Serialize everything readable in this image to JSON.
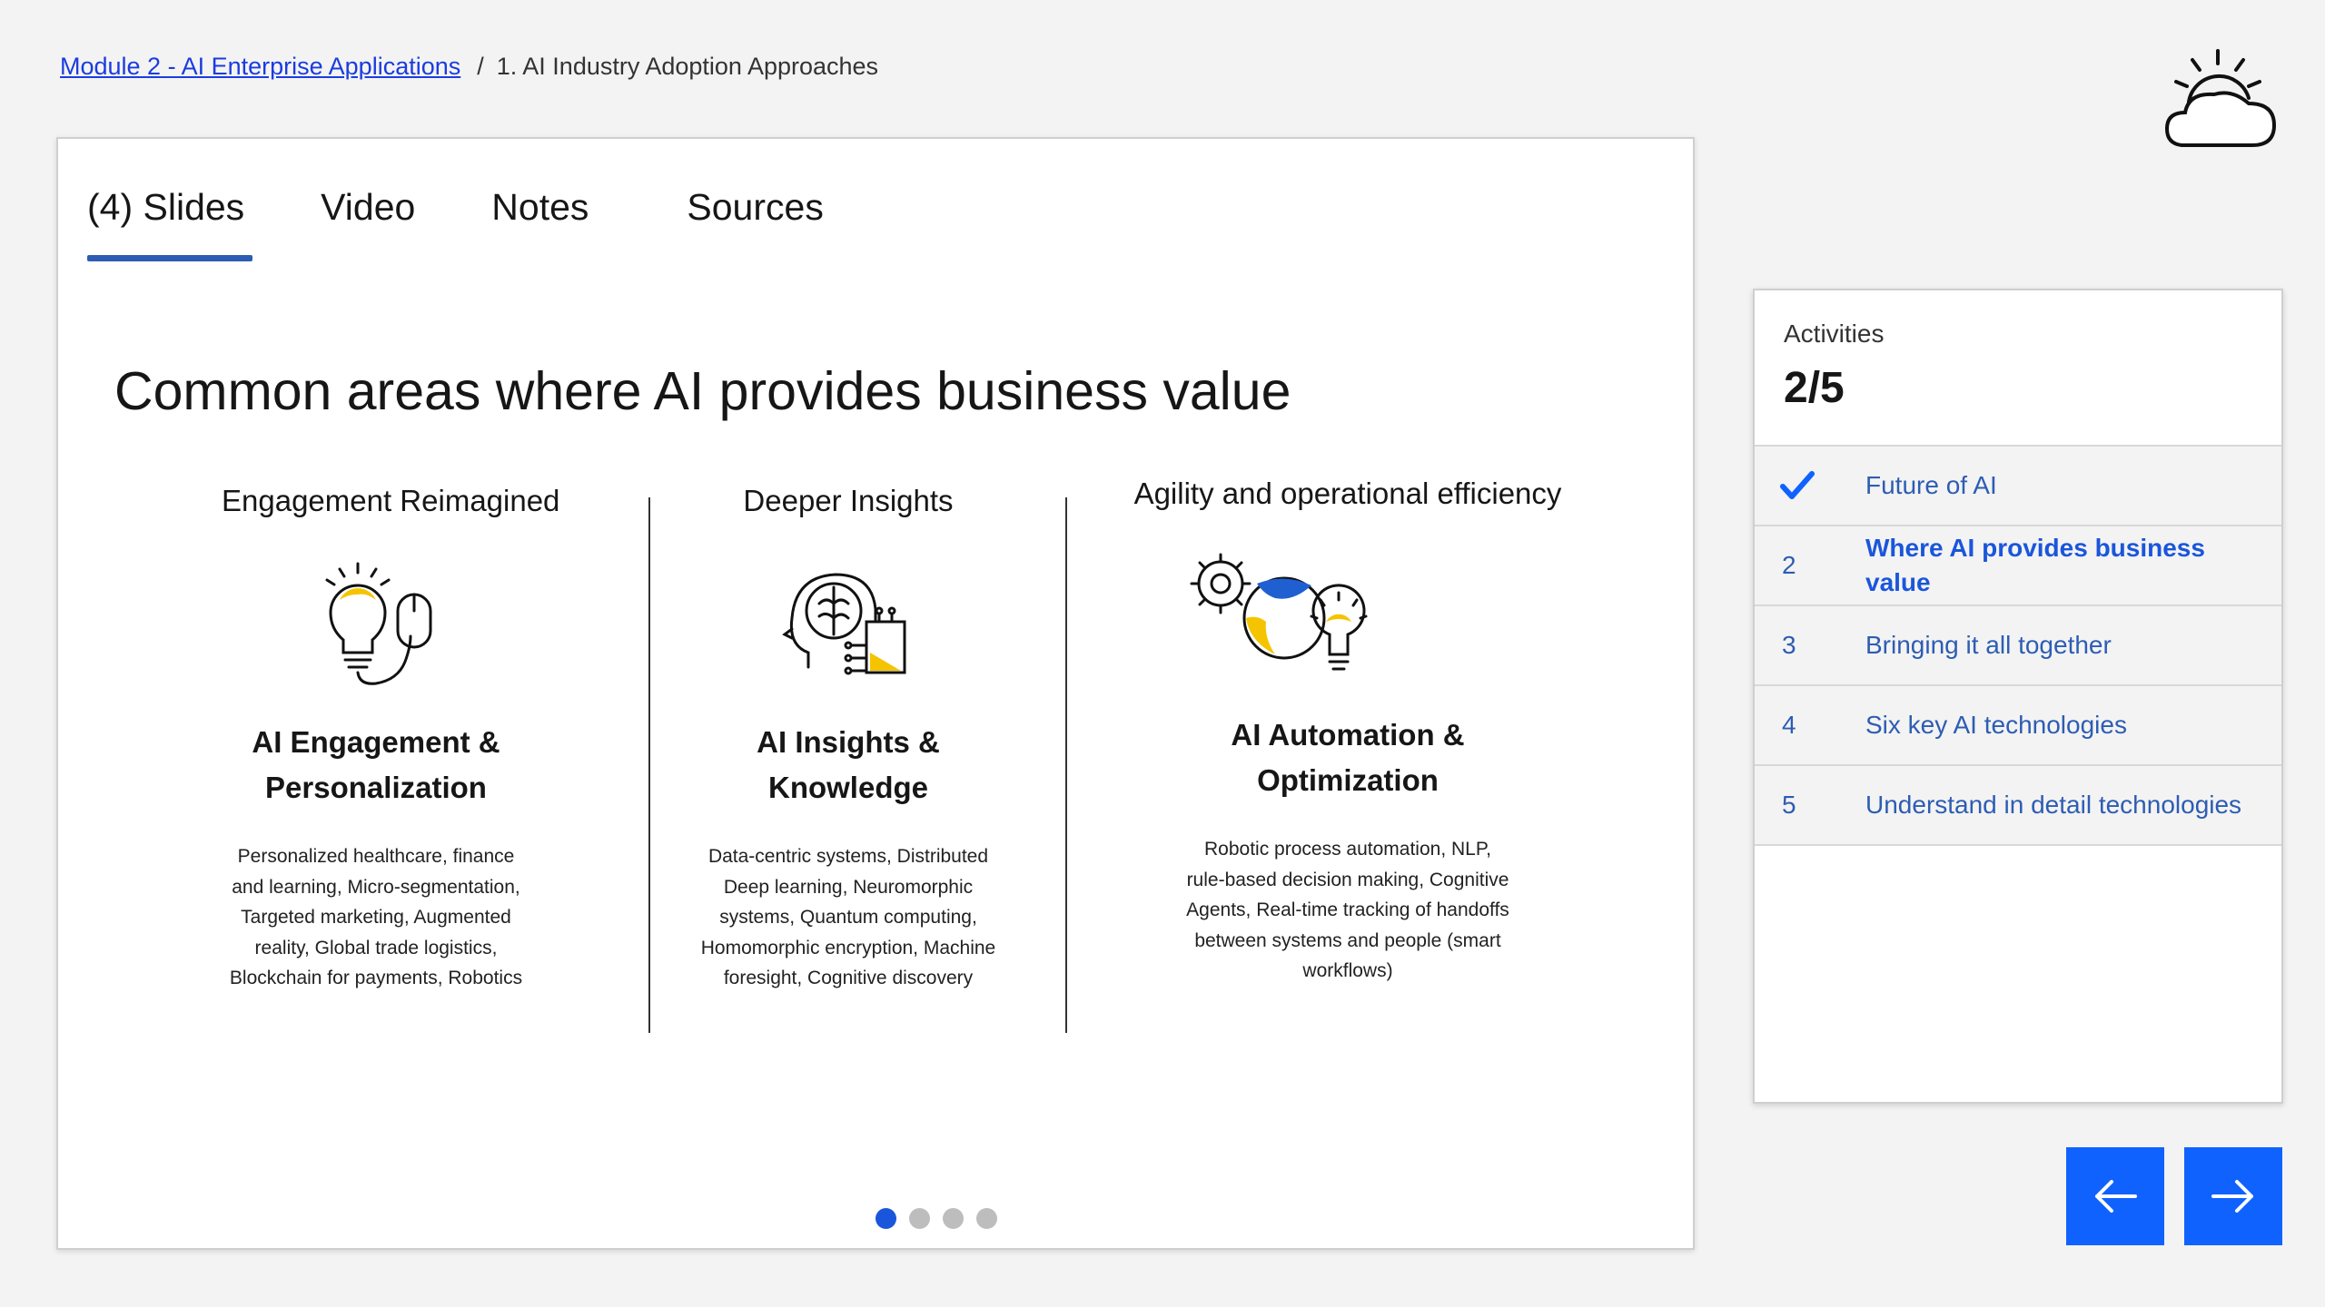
{
  "breadcrumb": {
    "parent": "Module 2 - AI Enterprise Applications",
    "separator": "/",
    "current": "1. AI Industry Adoption Approaches"
  },
  "logo": {
    "icon": "sun-cloud-logo"
  },
  "tabs": [
    {
      "label": "(4) Slides",
      "active": true
    },
    {
      "label": "Video"
    },
    {
      "label": "Notes"
    },
    {
      "label": "Sources"
    }
  ],
  "slide": {
    "title": "Common areas where AI provides business value",
    "columns": [
      {
        "heading": "Engagement Reimagined",
        "icon": "lightbulb-mouse-icon",
        "title_line1": "AI Engagement &",
        "title_line2": "Personalization",
        "desc": [
          "Personalized healthcare, finance",
          "and learning, Micro-segmentation,",
          "Targeted marketing, Augmented",
          "reality, Global trade logistics,",
          "Blockchain for payments, Robotics"
        ]
      },
      {
        "heading": "Deeper Insights",
        "icon": "brain-chart-icon",
        "title_line1": "AI Insights &",
        "title_line2": "Knowledge",
        "desc": [
          "Data-centric systems, Distributed",
          "Deep learning, Neuromorphic",
          "systems, Quantum computing,",
          "Homomorphic encryption, Machine",
          "foresight, Cognitive discovery"
        ]
      },
      {
        "heading": "Agility and operational efficiency",
        "icon": "gear-lightbulb-icon",
        "title_line1": "AI Automation &",
        "title_line2": "Optimization",
        "desc": [
          "Robotic process automation, NLP,",
          "rule-based decision making, Cognitive",
          "Agents, Real-time tracking of handoffs",
          "between systems and people (smart",
          "workflows)"
        ]
      }
    ],
    "pagination": {
      "total": 4,
      "current": 1
    }
  },
  "activities": {
    "label": "Activities",
    "progress": "2/5",
    "items": [
      {
        "num": "",
        "label": "Future of AI",
        "status": "completed"
      },
      {
        "num": "2",
        "label": "Where AI provides business value",
        "status": "current"
      },
      {
        "num": "3",
        "label": "Bringing it all together",
        "status": "pending"
      },
      {
        "num": "4",
        "label": "Six key AI technologies",
        "status": "pending"
      },
      {
        "num": "5",
        "label": "Understand in detail technologies",
        "status": "pending"
      }
    ]
  },
  "nav": {
    "prev_icon": "arrow-left-icon",
    "next_icon": "arrow-right-icon"
  },
  "colors": {
    "accent": "#0f62fe",
    "link": "#2d5db3",
    "yellow": "#f5c400",
    "icon_blue": "#1f5fd1"
  }
}
